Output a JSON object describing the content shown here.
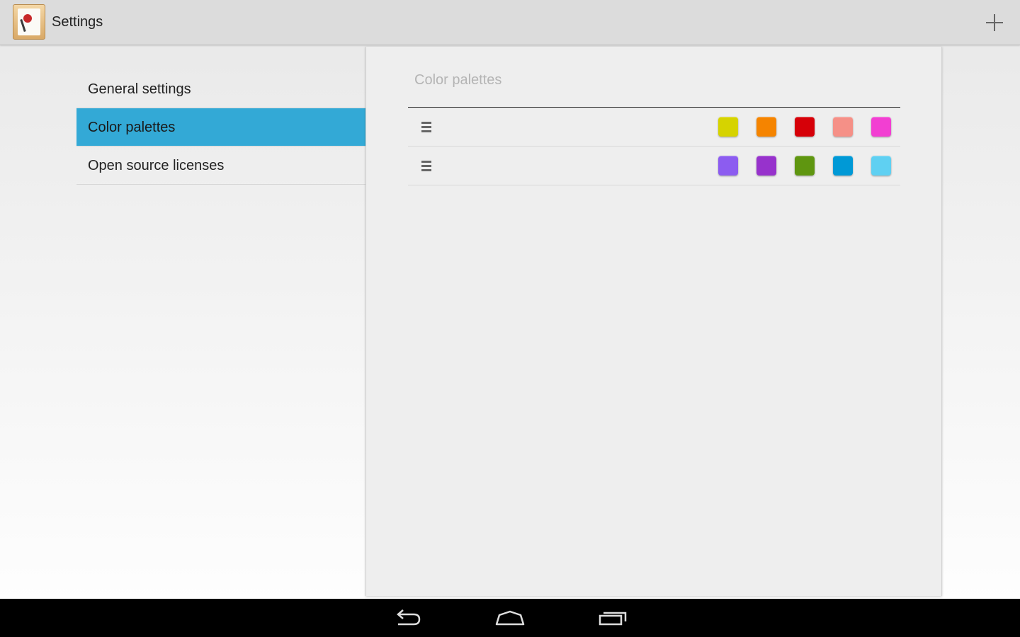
{
  "action_bar": {
    "title": "Settings",
    "app_icon": "paint-palette-app-icon",
    "add_icon": "plus-icon"
  },
  "headers": {
    "items": [
      {
        "label": "General settings",
        "selected": false
      },
      {
        "label": "Color palettes",
        "selected": true
      },
      {
        "label": "Open source licenses",
        "selected": false
      }
    ],
    "selected_color": "#33a9d6"
  },
  "panel": {
    "title": "Color palettes",
    "palettes": [
      {
        "colors": [
          "#d6d300",
          "#f58400",
          "#d60008",
          "#f59087",
          "#f23fd2"
        ]
      },
      {
        "colors": [
          "#8c5cf0",
          "#9732cc",
          "#5f9610",
          "#0099d6",
          "#5fd0f2"
        ]
      }
    ]
  },
  "nav_bar": {
    "icons": [
      "back-icon",
      "home-icon",
      "recent-apps-icon"
    ]
  }
}
